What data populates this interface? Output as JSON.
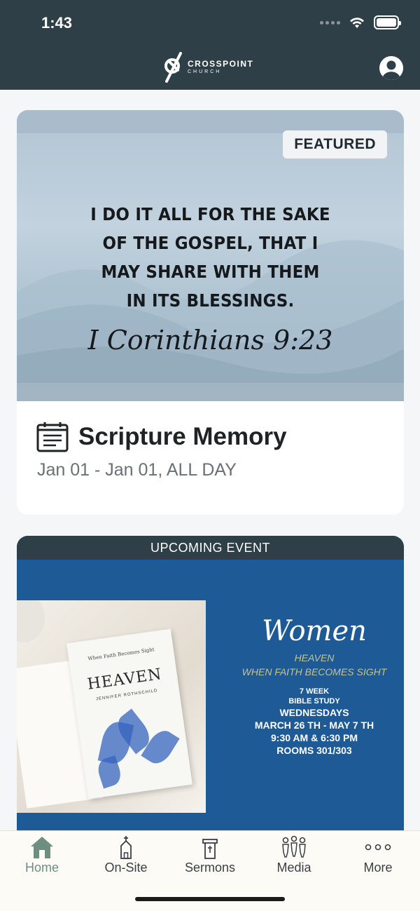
{
  "status_bar": {
    "time": "1:43"
  },
  "header": {
    "logo_main": "CROSSPOINT",
    "logo_sub": "CHURCH"
  },
  "featured_card": {
    "badge": "FEATURED",
    "quote_lines": [
      "I DO IT ALL FOR THE SAKE",
      "OF THE GOSPEL, THAT I",
      "MAY SHARE WITH THEM",
      "IN ITS BLESSINGS."
    ],
    "quote_ref": "I Corinthians 9:23",
    "title": "Scripture Memory",
    "date": "Jan 01 - Jan 01, ALL DAY",
    "icon": "calendar-icon"
  },
  "upcoming_card": {
    "label": "UPCOMING EVENT",
    "book_sub": "When Faith Becomes Sight",
    "book_title": "HEAVEN",
    "book_author": "JENNIFER ROTHSCHILD",
    "women": "Women",
    "heaven": "HEAVEN",
    "subtitle": "WHEN FAITH BECOMES SIGHT",
    "weeks": "7 WEEK",
    "study": "BIBLE STUDY",
    "day": "WEDNESDAYS",
    "dates": "MARCH 26 TH - MAY 7 TH",
    "times": "9:30 AM & 6:30 PM",
    "rooms": "ROOMS 301/303"
  },
  "tabs": [
    {
      "label": "Home",
      "icon": "home-icon",
      "active": true
    },
    {
      "label": "On-Site",
      "icon": "church-icon",
      "active": false
    },
    {
      "label": "Sermons",
      "icon": "pulpit-icon",
      "active": false
    },
    {
      "label": "Media",
      "icon": "people-icon",
      "active": false
    },
    {
      "label": "More",
      "icon": "more-icon",
      "active": false
    }
  ],
  "colors": {
    "header_bg": "#2f3f47",
    "event_bg": "#1d5a96",
    "active_tab": "#6e8f7f"
  }
}
